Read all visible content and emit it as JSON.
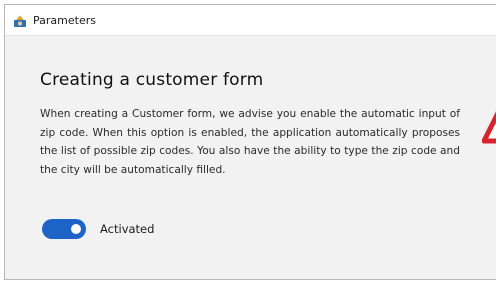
{
  "window": {
    "title": "Parameters",
    "icon": "gear-app-icon"
  },
  "section": {
    "heading": "Creating a customer form",
    "description": "When creating a Customer form, we advise you enable the automatic input of zip code. When this option is enabled, the application automatically proposes the list of possible zip codes. You also have the ability to type the zip code and the city will be automatically filled."
  },
  "toggle": {
    "label": "Activated",
    "checked": true
  },
  "colors": {
    "accent": "#1e64c8",
    "warning": "#d9232e"
  }
}
